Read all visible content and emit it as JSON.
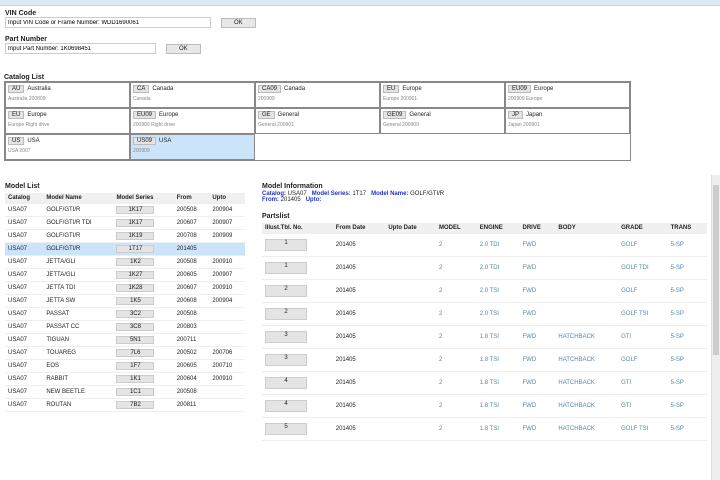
{
  "vin": {
    "label": "VIN Code",
    "value": "Input VIN Code or Frame Number: WDD1690061",
    "ok": "OK"
  },
  "part": {
    "label": "Part Number",
    "value": "Input Part Number: 1K0698451",
    "ok": "OK"
  },
  "catalog": {
    "label": "Catalog List",
    "items": [
      {
        "code": "AU",
        "name": "Australia",
        "sub": "Australia 200809"
      },
      {
        "code": "CA",
        "name": "Canada",
        "sub": "Canada"
      },
      {
        "code": "CA09",
        "name": "Canada",
        "sub": "200909"
      },
      {
        "code": "EU",
        "name": "Europe",
        "sub": "Europe 200901"
      },
      {
        "code": "EU09",
        "name": "Europe",
        "sub": "200909 Europe"
      },
      {
        "code": "EU",
        "name": "Europe",
        "sub": "Europe Right drive"
      },
      {
        "code": "EU09",
        "name": "Europe",
        "sub": "200909 Right drive"
      },
      {
        "code": "GE",
        "name": "General",
        "sub": "General 200901"
      },
      {
        "code": "GE09",
        "name": "General",
        "sub": "General 200909"
      },
      {
        "code": "JP",
        "name": "Japan",
        "sub": "Japan 200901"
      },
      {
        "code": "US",
        "name": "USA",
        "sub": "USA 2007"
      },
      {
        "code": "US09",
        "name": "USA",
        "sub": "200909"
      }
    ]
  },
  "models": {
    "label": "Model List",
    "headers": [
      "Catalog",
      "Model Name",
      "Model Series",
      "From",
      "Upto"
    ],
    "rows": [
      [
        "USA07",
        "GOLF/GTI/R",
        "1K17",
        "200508",
        "200904"
      ],
      [
        "USA07",
        "GOLF/GTI/R TDI",
        "1K17",
        "200607",
        "200907"
      ],
      [
        "USA07",
        "GOLF/GTI/R",
        "1K19",
        "200708",
        "200909"
      ],
      [
        "USA07",
        "GOLF/GTI/R",
        "1T17",
        "201405",
        ""
      ],
      [
        "USA07",
        "JETTA/GLI",
        "1K2",
        "200508",
        "200910"
      ],
      [
        "USA07",
        "JETTA/GLI",
        "1K27",
        "200605",
        "200907"
      ],
      [
        "USA07",
        "JETTA TDI",
        "1K28",
        "200607",
        "200910"
      ],
      [
        "USA07",
        "JETTA SW",
        "1K5",
        "200608",
        "200904"
      ],
      [
        "USA07",
        "PASSAT",
        "3C2",
        "200508",
        ""
      ],
      [
        "USA07",
        "PASSAT CC",
        "3C8",
        "200803",
        ""
      ],
      [
        "USA07",
        "TIGUAN",
        "5N1",
        "200711",
        ""
      ],
      [
        "USA07",
        "TOUAREG",
        "7L6",
        "200502",
        "200706"
      ],
      [
        "USA07",
        "EOS",
        "1F7",
        "200605",
        "200710"
      ],
      [
        "USA07",
        "RABBIT",
        "1K1",
        "200604",
        "200910"
      ],
      [
        "USA07",
        "NEW BEETLE",
        "1C1",
        "200508",
        ""
      ],
      [
        "USA07",
        "ROUTAN",
        "7B2",
        "200811",
        ""
      ]
    ]
  },
  "info": {
    "label": "Model Information",
    "catalog_label": "Catalog:",
    "catalog": "USA07",
    "series_label": "Model Series:",
    "series": "1T17",
    "name_label": "Model Name:",
    "name": "GOLF/GTI/R",
    "from_label": "From:",
    "from": "201405",
    "upto_label": "Upto:"
  },
  "parts": {
    "label": "Partslist",
    "headers": [
      "Illust.Tbl. No.",
      "From Date",
      "Upto Date",
      "MODEL",
      "ENGINE",
      "DRIVE",
      "BODY",
      "GRADE",
      "TRANS"
    ],
    "rows": [
      [
        "1",
        "201405",
        "",
        "2",
        "2.0 TDI",
        "FWD",
        "",
        "GOLF",
        "5-SP"
      ],
      [
        "1",
        "201405",
        "",
        "2",
        "2.0 TDI",
        "FWD",
        "",
        "GOLF TDI",
        "5-SP"
      ],
      [
        "2",
        "201405",
        "",
        "2",
        "2.0 TSI",
        "FWD",
        "",
        "GOLF",
        "5-SP"
      ],
      [
        "2",
        "201405",
        "",
        "2",
        "2.0 TSI",
        "FWD",
        "",
        "GOLF TSI",
        "5-SP"
      ],
      [
        "3",
        "201405",
        "",
        "2",
        "1.8 TSI",
        "FWD",
        "HATCHBACK",
        "GTI",
        "5-SP"
      ],
      [
        "3",
        "201405",
        "",
        "2",
        "1.8 TSI",
        "FWD",
        "HATCHBACK",
        "GOLF",
        "5-SP"
      ],
      [
        "4",
        "201405",
        "",
        "2",
        "1.8 TSI",
        "FWD",
        "HATCHBACK",
        "GTI",
        "5-SP"
      ],
      [
        "4",
        "201405",
        "",
        "2",
        "1.8 TSI",
        "FWD",
        "HATCHBACK",
        "GTI",
        "5-SP"
      ],
      [
        "5",
        "201405",
        "",
        "2",
        "1.8 TSI",
        "FWD",
        "HATCHBACK",
        "GOLF TSI",
        "5-SP"
      ]
    ]
  }
}
